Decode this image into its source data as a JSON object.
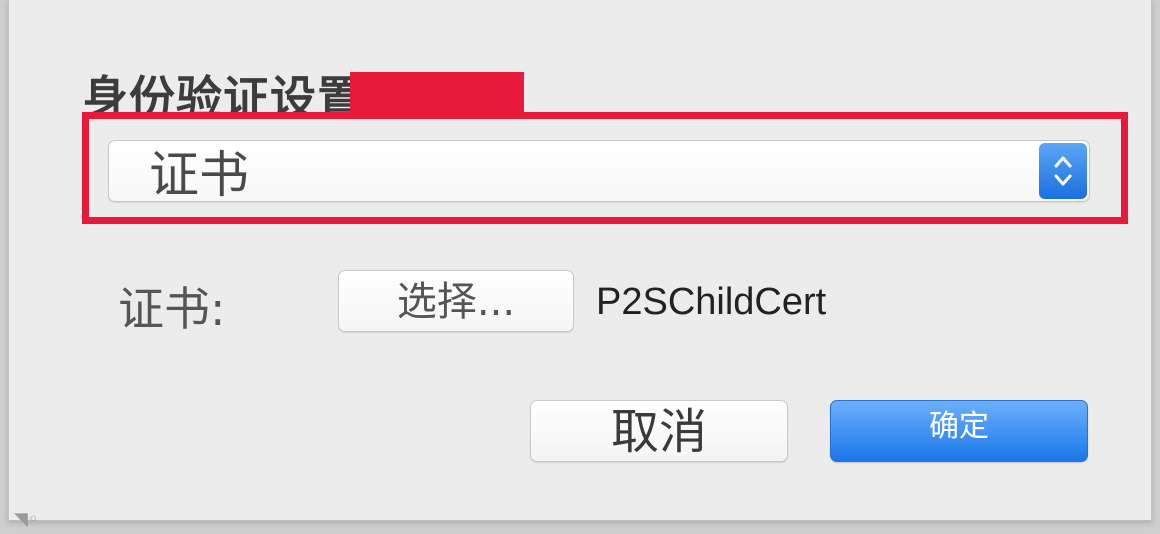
{
  "auth": {
    "section_label": "身份验证设置:",
    "method_selected": "证书"
  },
  "certificate": {
    "label": "证书:",
    "choose_button": "选择...",
    "selected_name": "P2SChildCert"
  },
  "actions": {
    "cancel_label": "取消",
    "ok_label": "确定"
  },
  "colors": {
    "highlight": "#e8193b",
    "accent": "#1c77ec"
  },
  "icons": {
    "popup_arrows": "chevron-up-down-icon",
    "edge_mark": "chevron-icon"
  }
}
